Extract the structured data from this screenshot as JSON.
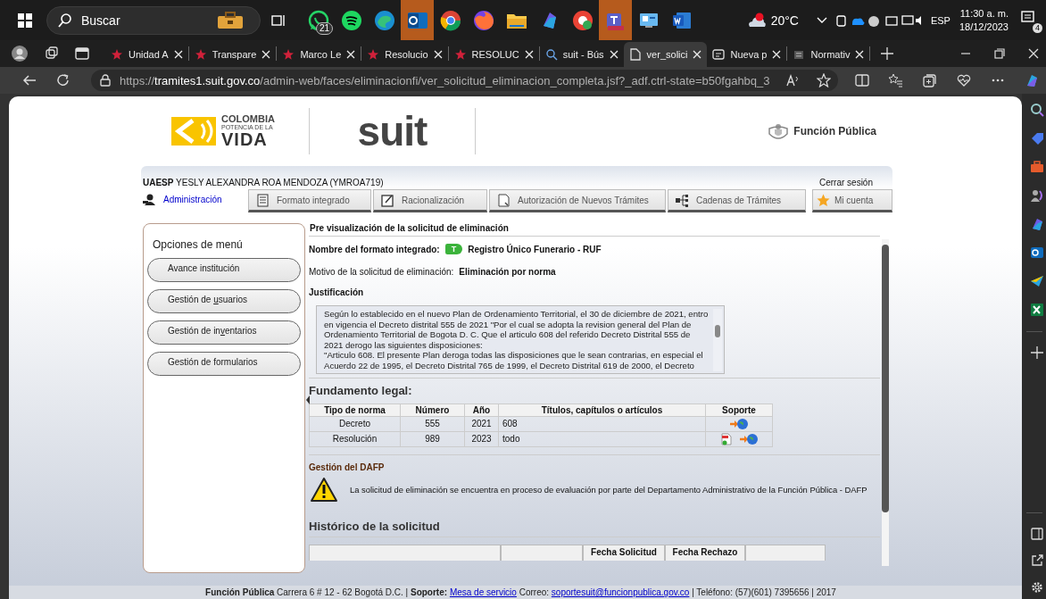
{
  "taskbar": {
    "search": {
      "placeholder": "Buscar"
    },
    "whatsapp_badge": "21",
    "weather": "20°C",
    "language": "ESP",
    "time": "11:30 a. m.",
    "date": "18/12/2023",
    "notification_count": "4"
  },
  "browser": {
    "tabs": [
      {
        "kind": "star",
        "title": "Unidad A",
        "selected": false
      },
      {
        "kind": "star",
        "title": "Transpare",
        "selected": false
      },
      {
        "kind": "star",
        "title": "Marco Le",
        "selected": false
      },
      {
        "kind": "star",
        "title": "Resolucio",
        "selected": false
      },
      {
        "kind": "star",
        "title": "RESOLUC",
        "selected": false
      },
      {
        "kind": "search",
        "title": "suit - Bús",
        "selected": false
      },
      {
        "kind": "page",
        "title": "ver_solici",
        "selected": true
      },
      {
        "kind": "newtab",
        "title": "Nueva p",
        "selected": false
      },
      {
        "kind": "doc",
        "title": "Normativ",
        "selected": false
      }
    ],
    "url_scheme": "https://",
    "url_host": "tramites1.suit.gov.co",
    "url_path": "/admin-web/faces/eliminacionfi/ver_solicitud_eliminacion_completa.jsf?_adf.ctrl-state=b50fgahbq_3"
  },
  "header": {
    "logo_line_1": "COLOMBIA",
    "logo_line_2": "POTENCIA DE LA",
    "logo_line_3": "VIDA",
    "app_logo": "suit",
    "agency": "Función Pública"
  },
  "user": {
    "entity": "UAESP",
    "name": "YESLY ALEXANDRA ROA MENDOZA (YMROA719)",
    "logout": "Cerrar sesión"
  },
  "nav_tabs": [
    {
      "kind": "admin",
      "label": "Administración",
      "selected": true
    },
    {
      "kind": "form",
      "label": "Formato integrado",
      "selected": false
    },
    {
      "kind": "edit",
      "label": "Racionalización",
      "selected": false
    },
    {
      "kind": "doc",
      "label": "Autorización de Nuevos Trámites",
      "selected": false
    },
    {
      "kind": "chain",
      "label": "Cadenas de Trámites",
      "selected": false
    }
  ],
  "account_tab": {
    "label": "Mi cuenta"
  },
  "sidebar": {
    "title": "Opciones de menú",
    "items": [
      {
        "before": "Avance institución"
      },
      {
        "before": "Gestión de ",
        "access_key": "u",
        "after": "suarios"
      },
      {
        "before": "Gestión de in",
        "access_key": "v",
        "after": "entarios"
      },
      {
        "before": "Gestión de formularios"
      }
    ]
  },
  "content": {
    "title": "Pre visualización de la solicitud de eliminación",
    "format_label": "Nombre del formato integrado:",
    "format_badge": "T",
    "format_name": "Registro Único Funerario - RUF",
    "reason_label": "Motivo de la solicitud de eliminación:",
    "reason_value": "Eliminación por norma",
    "justification_label": "Justificación",
    "justification_text": "Según lo establecido en el nuevo Plan de Ordenamiento Territorial, el 30 de diciembre de 2021, entro en vigencia el Decreto distrital 555 de 2021 \"Por el cual se adopta la revision general del Plan de Ordenamiento Territorial de Bogota D. C. Que el articulo 608 del referido Decreto Distrital 555 de 2021 derogo las siguientes disposiciones:\n\"Articulo 608. El presente Plan deroga todas las disposiciones que le sean contrarias, en especial el Acuerdo 22 de 1995, el Decreto Distrital 765 de 1999, el Decreto Distrital 619 de 2000, el Decreto",
    "legal_title": "Fundamento legal:",
    "legal_table": {
      "columns": [
        "Tipo de norma",
        "Número",
        "Año",
        "Títulos, capítulos o artículos",
        "Soporte"
      ],
      "rows": [
        {
          "type": "Decreto",
          "number": "555",
          "year": "2021",
          "articles": "608",
          "support": [
            {
              "kind": "link"
            }
          ]
        },
        {
          "type": "Resolución",
          "number": "989",
          "year": "2023",
          "articles": "todo",
          "support": [
            {
              "kind": "pdf"
            },
            {
              "kind": "link"
            }
          ]
        }
      ]
    },
    "dafp_title": "Gestión del DAFP",
    "dafp_message": "La solicitud de eliminación se encuentra en proceso de evaluación por parte del Departamento Administrativo de la Función Pública - DAFP",
    "history_title": "Histórico de la solicitud",
    "history_columns": [
      {},
      {},
      {
        "label": "Fecha Solicitud"
      },
      {
        "label": "Fecha Rechazo"
      },
      {}
    ]
  },
  "footer": [
    {
      "kind": "text",
      "text": "**Función Pública** Carrera 6 # 12 - 62 Bogotá D.C. | **Soporte:**"
    },
    {
      "kind": "link",
      "text": "Mesa de servicio"
    },
    {
      "kind": "text",
      "text": "Correo:"
    },
    {
      "kind": "link",
      "text": "soportesuit@funcionpublica.gov.co"
    },
    {
      "kind": "text",
      "text": "| Teléfono: (57)(601) 7395656 | 2017"
    }
  ]
}
